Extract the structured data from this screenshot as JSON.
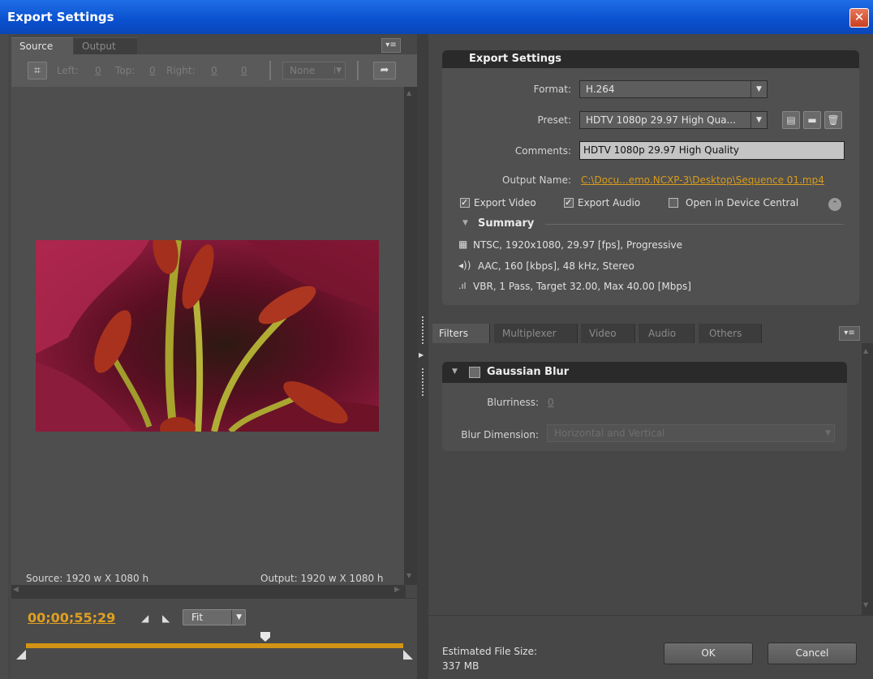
{
  "window": {
    "title": "Export Settings",
    "close_glyph": "✕"
  },
  "left": {
    "tabs": [
      {
        "label": "Source"
      },
      {
        "label": "Output"
      }
    ],
    "crop": {
      "left_label": "Left:",
      "left_value": "0",
      "top_label": "Top:",
      "top_value": "0",
      "right_label": "Right:",
      "right_value": "0",
      "bottom_value": "0",
      "ratio_value": "None"
    },
    "source_info": "Source: 1920 w X 1080 h",
    "output_info": "Output: 1920 w X 1080 h",
    "timecode": "00;00;55;29",
    "zoom_value": "Fit"
  },
  "export_settings": {
    "header": "Export Settings",
    "format_label": "Format:",
    "format_value": "H.264",
    "preset_label": "Preset:",
    "preset_value": "HDTV 1080p 29.97 High Qua...",
    "comments_label": "Comments:",
    "comments_value": "HDTV 1080p 29.97 High Quality",
    "output_name_label": "Output Name:",
    "output_name_value": "C:\\Docu...emo.NCXP-3\\Desktop\\Sequence 01.mp4",
    "export_video_label": "Export Video",
    "export_video_checked": true,
    "export_audio_label": "Export Audio",
    "export_audio_checked": true,
    "device_central_label": "Open in Device Central",
    "device_central_checked": false,
    "summary_label": "Summary",
    "summary_video": "NTSC, 1920x1080, 29.97 [fps], Progressive",
    "summary_audio": "AAC, 160 [kbps], 48 kHz, Stereo",
    "summary_bitrate": "VBR, 1 Pass, Target 32.00, Max 40.00 [Mbps]"
  },
  "tabs2": [
    {
      "label": "Filters"
    },
    {
      "label": "Multiplexer"
    },
    {
      "label": "Video"
    },
    {
      "label": "Audio"
    },
    {
      "label": "Others"
    }
  ],
  "filter": {
    "name": "Gaussian Blur",
    "blurriness_label": "Blurriness:",
    "blurriness_value": "0",
    "dimension_label": "Blur Dimension:",
    "dimension_value": "Horizontal and Vertical"
  },
  "footer": {
    "size_label": "Estimated File Size:",
    "size_value": "337 MB",
    "ok_label": "OK",
    "cancel_label": "Cancel"
  },
  "colors": {
    "accent": "#d29414",
    "title_blue": "#0a50cf",
    "link": "#e0a020"
  },
  "preview_image": "red lily flower stamens close-up"
}
